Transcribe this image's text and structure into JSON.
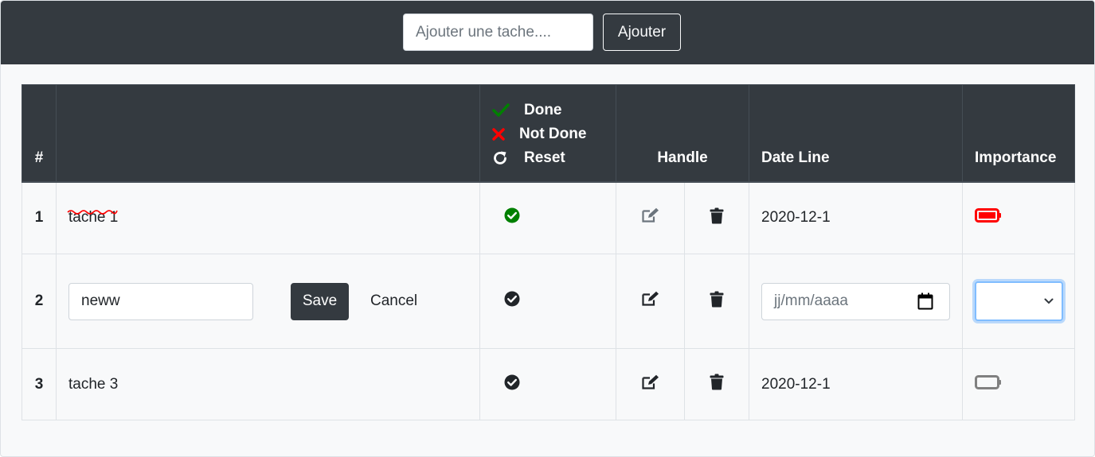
{
  "toolbar": {
    "add_placeholder": "Ajouter une tache....",
    "add_button": "Ajouter"
  },
  "table": {
    "headers": {
      "number": "#",
      "task": "",
      "handle": "Handle",
      "date_line": "Date Line",
      "importance": "Importance"
    },
    "legend": {
      "done": "Done",
      "not_done": "Not Done",
      "reset": "Reset"
    },
    "rows": [
      {
        "num": "1",
        "text": "tache 1",
        "status": "done",
        "status_icon": "check-circle-icon",
        "status_color": "#008000",
        "date": "2020-12-1",
        "importance_icon": "battery-full-icon",
        "importance_color": "#ff0000"
      },
      {
        "num": "2",
        "editing": true,
        "edit_value": "neww",
        "save_label": "Save",
        "cancel_label": "Cancel",
        "status_icon": "check-circle-icon",
        "date_placeholder": "jj/mm/aaaa",
        "importance_value": ""
      },
      {
        "num": "3",
        "text": "tache 3",
        "status_icon": "check-circle-icon",
        "date": "2020-12-1",
        "importance_icon": "battery-empty-icon",
        "importance_color": "#808080"
      }
    ]
  },
  "colors": {
    "header_bg": "#343a40",
    "done_green": "#008000",
    "not_done_red": "#ff0000",
    "focus_blue": "#80bdff"
  }
}
